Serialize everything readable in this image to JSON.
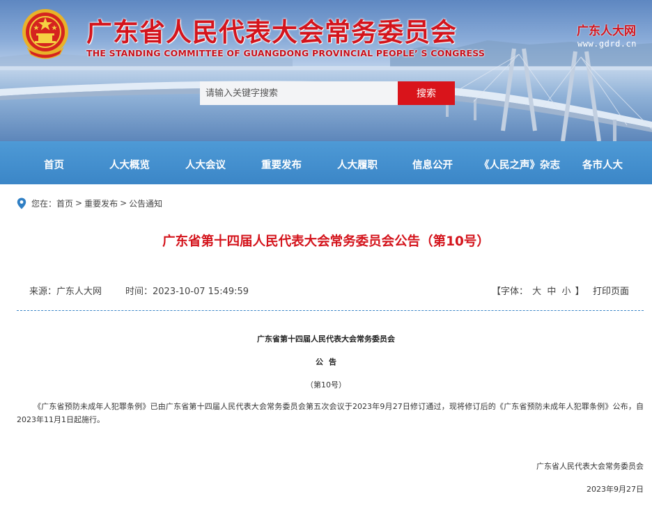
{
  "header": {
    "title": "广东省人民代表大会常务委员会",
    "subtitle": "THE STANDING COMMITTEE OF GUANGDONG PROVINCIAL PEOPLE’ S CONGRESS",
    "brand_logo": "广东人大网",
    "brand_url": "www.gdrd.cn"
  },
  "search": {
    "placeholder": "请输入关键字搜索",
    "button_label": "搜索"
  },
  "nav": {
    "items": [
      {
        "label": "首页"
      },
      {
        "label": "人大概览"
      },
      {
        "label": "人大会议"
      },
      {
        "label": "重要发布"
      },
      {
        "label": "人大履职"
      },
      {
        "label": "信息公开"
      },
      {
        "label": "《人民之声》杂志"
      },
      {
        "label": "各市人大"
      }
    ]
  },
  "breadcrumb": {
    "prefix": "您在：",
    "items": [
      "首页",
      "重要发布",
      "公告通知"
    ],
    "separator": ">"
  },
  "article": {
    "title": "广东省第十四届人民代表大会常务委员会公告（第10号）",
    "source": "来源：广东人大网",
    "time": "时间：2023-10-07 15:49:59",
    "font_ctrl_prefix": "【字体：",
    "font_sizes": [
      "大",
      "中",
      "小"
    ],
    "font_ctrl_suffix": "】",
    "print_label": "打印页面",
    "org_line": "广东省第十四届人民代表大会常务委员会",
    "notice_line": "公告",
    "number_line": "（第10号）",
    "paragraph": "《广东省预防未成年人犯罪条例》已由广东省第十四届人民代表大会常务委员会第五次会议于2023年9月27日修订通过，现将修订后的《广东省预防未成年人犯罪条例》公布，自2023年11月1日起施行。",
    "signature_org": "广东省人民代表大会常务委员会",
    "signature_date": "2023年9月27日"
  },
  "colors": {
    "brand_red": "#d4141c",
    "nav_blue": "#3b86c7",
    "search_button": "#d9141b"
  }
}
